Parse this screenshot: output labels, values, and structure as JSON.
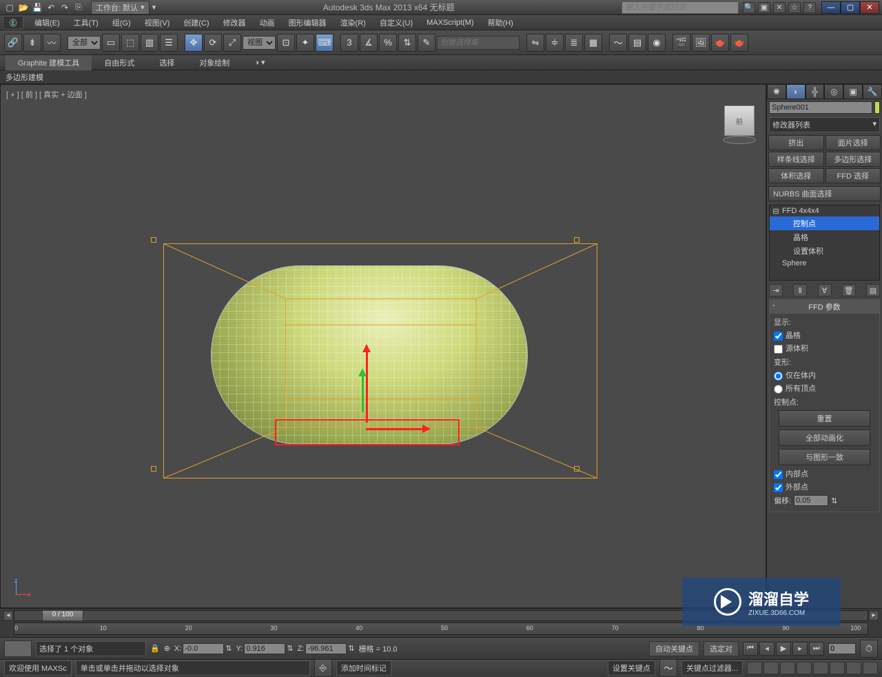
{
  "titlebar": {
    "workspace_label": "工作台: 默认",
    "app_title": "Autodesk 3ds Max  2013 x64     无标题",
    "search_placeholder": "键入关键字或短语"
  },
  "menu": {
    "items": [
      "编辑(E)",
      "工具(T)",
      "组(G)",
      "视图(V)",
      "创建(C)",
      "修改器",
      "动画",
      "图形编辑器",
      "渲染(R)",
      "自定义(U)",
      "MAXScript(M)",
      "帮助(H)"
    ]
  },
  "toolbar": {
    "sel_filter": "全部",
    "ref_sys": "视图",
    "named_sel": "创建选择集"
  },
  "ribbon": {
    "tabs": [
      "Graphite 建模工具",
      "自由形式",
      "选择",
      "对象绘制"
    ],
    "sub": "多边形建模"
  },
  "viewport": {
    "label": "[ + ] [ 前 ] [ 真实 + 边面 ]",
    "viewcube": "前"
  },
  "cmd_panel": {
    "object_name": "Sphere001",
    "modlist_label": "修改器列表",
    "selset_buttons": [
      "挤出",
      "面片选择",
      "样条线选择",
      "多边形选择",
      "体积选择",
      "FFD 选择"
    ],
    "nurbs_btn": "NURBS 曲面选择",
    "stack": {
      "mod": "FFD 4x4x4",
      "children": [
        "控制点",
        "晶格",
        "设置体积"
      ],
      "base": "Sphere"
    },
    "rollout": {
      "title": "FFD 参数",
      "display_label": "显示:",
      "lattice": "晶格",
      "source_vol": "源体积",
      "deform_label": "变形:",
      "only_in_vol": "仅在体内",
      "all_verts": "所有顶点",
      "cp_label": "控制点:",
      "reset": "重置",
      "anim_all": "全部动画化",
      "conform": "与图形一致",
      "inner": "内部点",
      "outer": "外部点",
      "offset_label": "偏移:",
      "offset_val": "0.05"
    }
  },
  "timeline": {
    "slider": "0 / 100",
    "ticks": [
      "0",
      "10",
      "20",
      "30",
      "40",
      "50",
      "60",
      "70",
      "80",
      "90",
      "100"
    ]
  },
  "status": {
    "sel_count": "选择了 1 个对象",
    "x": "-0.0",
    "y": "0.916",
    "z": "-96.961",
    "grid": "栅格 = 10.0",
    "autokey": "自动关键点",
    "selkey": "选定对",
    "welcome": "欢迎使用 MAXSc",
    "hint": "单击或单击并拖动以选择对象",
    "addtime": "添加时间标记",
    "setkey": "设置关键点",
    "keyfilter": "关键点过滤器..."
  },
  "watermark": {
    "title": "溜溜自学",
    "sub": "ZIXUE.3D66.COM"
  }
}
